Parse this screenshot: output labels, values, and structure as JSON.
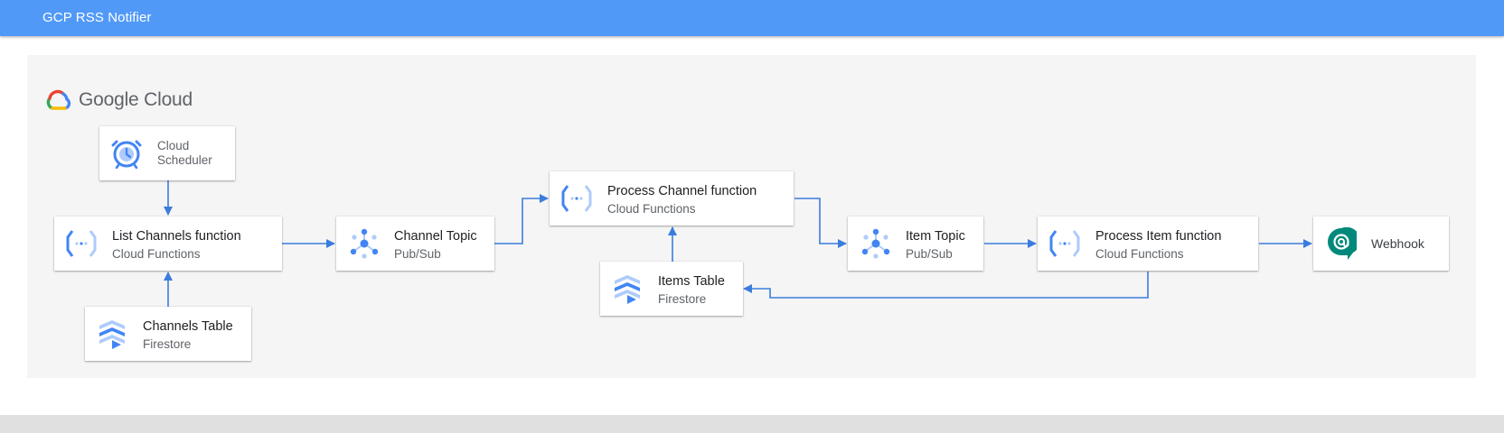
{
  "header": {
    "title": "GCP RSS Notifier"
  },
  "brand": {
    "name": "Google Cloud"
  },
  "nodes": {
    "scheduler": {
      "line1": "Cloud",
      "line2": "Scheduler"
    },
    "list_channels": {
      "title": "List Channels function",
      "subtitle": "Cloud Functions"
    },
    "channels_table": {
      "title": "Channels Table",
      "subtitle": "Firestore"
    },
    "channel_topic": {
      "title": "Channel Topic",
      "subtitle": "Pub/Sub"
    },
    "process_channel": {
      "title": "Process Channel function",
      "subtitle": "Cloud Functions"
    },
    "items_table": {
      "title": "Items Table",
      "subtitle": "Firestore"
    },
    "item_topic": {
      "title": "Item Topic",
      "subtitle": "Pub/Sub"
    },
    "process_item": {
      "title": "Process Item function",
      "subtitle": "Cloud Functions"
    },
    "webhook": {
      "title": "Webhook"
    }
  },
  "colors": {
    "header": "#5199f7",
    "edge": "#3b7ddd",
    "icon_blue": "#4285f4",
    "icon_light": "#aecbfa",
    "webhook_green": "#00897b"
  },
  "icons": {
    "scheduler": "clock-icon",
    "functions": "cloud-functions-icon",
    "pubsub": "pubsub-icon",
    "firestore": "firestore-icon",
    "webhook": "chat-at-icon"
  }
}
